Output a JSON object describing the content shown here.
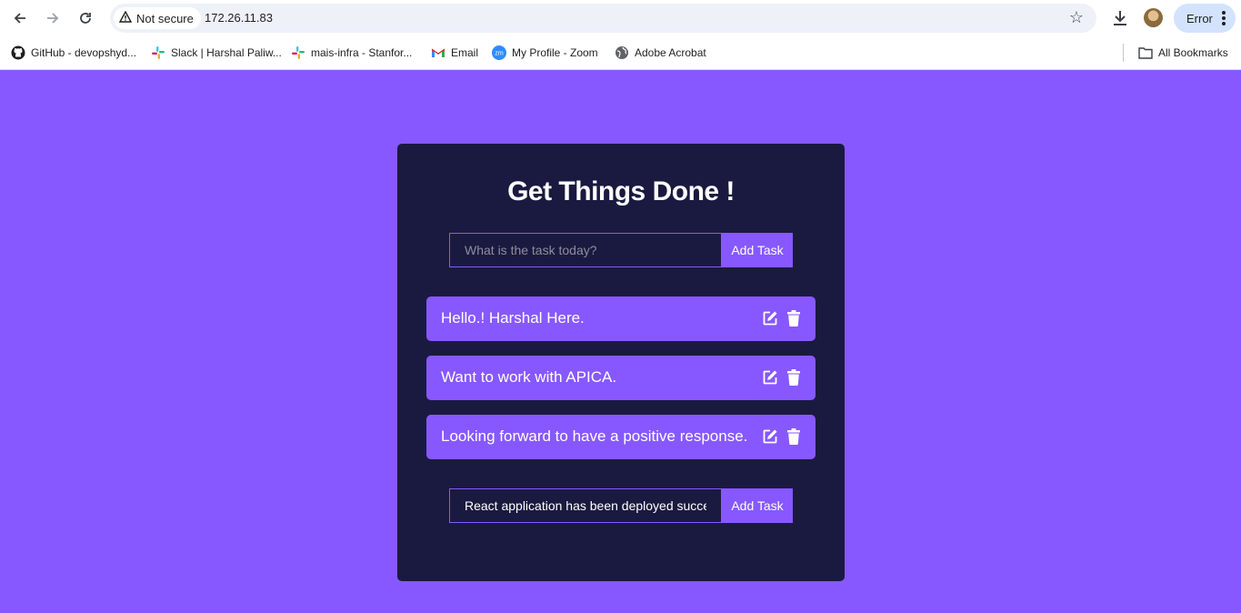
{
  "browser": {
    "security_label": "Not secure",
    "url": "172.26.11.83",
    "profile_status": "Error",
    "icons": [
      "back-icon",
      "forward-icon",
      "reload-icon",
      "warning-icon",
      "bookmark-star-icon",
      "download-icon",
      "kebab-menu-icon"
    ]
  },
  "bookmarks": {
    "items": [
      {
        "label": "GitHub - devopshyd...",
        "icon": "github-icon"
      },
      {
        "label": "Slack | Harshal Paliw...",
        "icon": "slack-icon"
      },
      {
        "label": "mais-infra - Stanfor...",
        "icon": "slack-icon"
      },
      {
        "label": "Email",
        "icon": "gmail-icon"
      },
      {
        "label": "My Profile - Zoom",
        "icon": "zoom-icon"
      },
      {
        "label": "Adobe Acrobat",
        "icon": "globe-icon"
      }
    ],
    "all_bookmarks": "All Bookmarks"
  },
  "app": {
    "title": "Get Things Done !",
    "new_task": {
      "placeholder": "What is the task today?",
      "value": "",
      "button": "Add Task"
    },
    "todos": [
      {
        "text": "Hello.! Harshal Here."
      },
      {
        "text": "Want to work with APICA."
      },
      {
        "text": "Looking forward to have a positive response."
      }
    ],
    "edit_form": {
      "value": "React application has been deployed successfully",
      "button": "Add Task"
    }
  },
  "colors": {
    "page_background": "#8758ff",
    "card_background": "#1a1a40",
    "accent": "#8758ff",
    "text": "#ffffff"
  }
}
